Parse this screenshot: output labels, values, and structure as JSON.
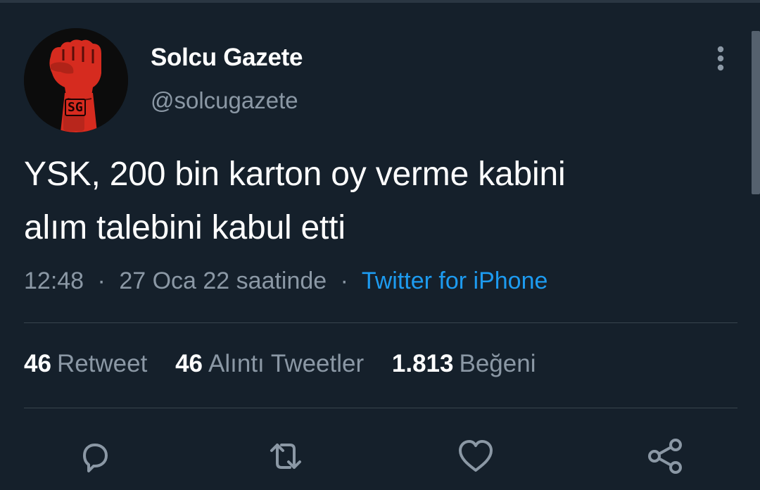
{
  "tweet": {
    "display_name": "Solcu Gazete",
    "handle": "@solcugazete",
    "avatar_text": "SG",
    "text_line1": "YSK, 200 bin karton oy verme kabini",
    "text_line2": "alım talebini kabul etti",
    "time": "12:48",
    "date": "27 Oca 22 saatinde",
    "separator": "·",
    "source": "Twitter for iPhone"
  },
  "stats": [
    {
      "count": "46",
      "label": "Retweet"
    },
    {
      "count": "46",
      "label": "Alıntı Tweetler"
    },
    {
      "count": "1.813",
      "label": "Beğeni"
    }
  ],
  "icons": {
    "more": "more-vertical-icon",
    "reply": "reply-icon",
    "retweet": "retweet-icon",
    "like": "heart-icon",
    "share": "share-icon"
  },
  "colors": {
    "background": "#15202b",
    "text_primary": "#ffffff",
    "text_secondary": "#8b98a5",
    "link": "#1d9bf0",
    "divider": "#38444d",
    "avatar_fist": "#d62b1f"
  }
}
